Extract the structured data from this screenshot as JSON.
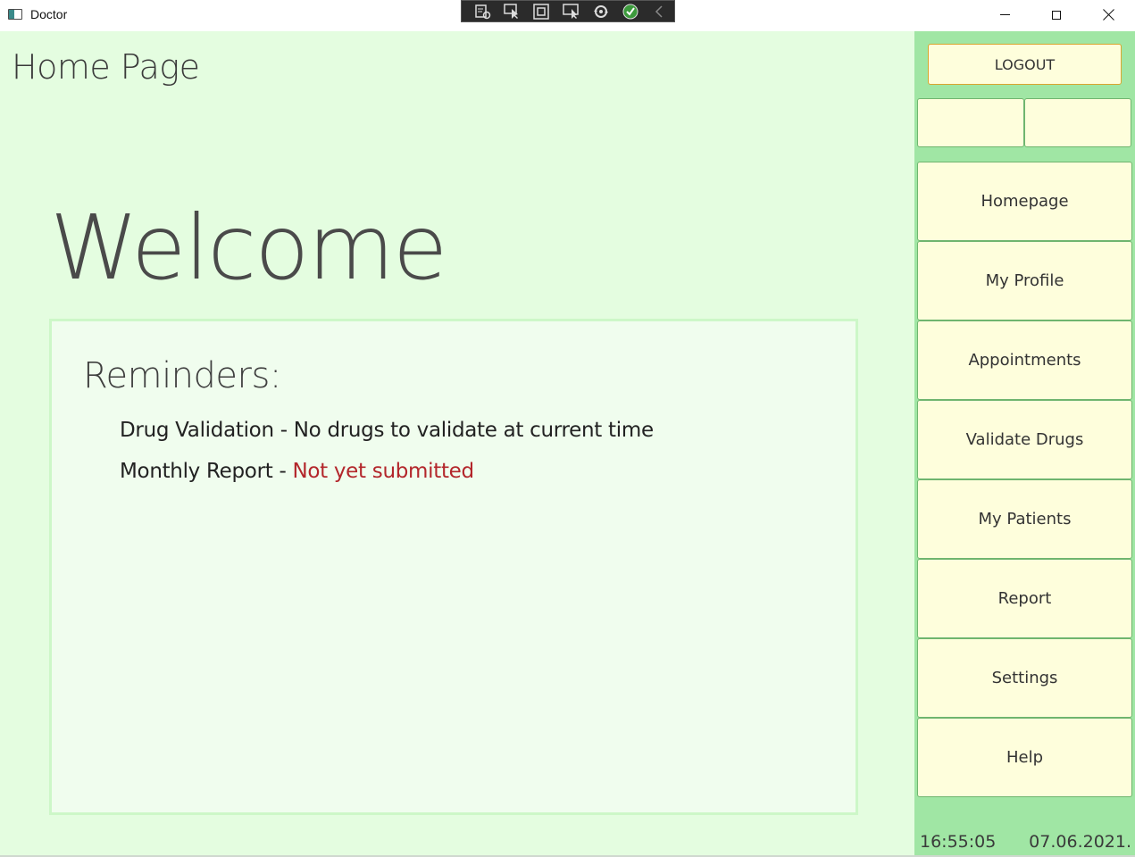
{
  "window": {
    "title": "Doctor"
  },
  "main": {
    "page_title": "Home Page",
    "welcome": "Welcome",
    "reminders": {
      "title": "Reminders:",
      "items": [
        {
          "label": "Drug Validation - No drugs to validate at current time",
          "status": ""
        },
        {
          "label": "Monthly Report - ",
          "status": "Not yet submitted"
        }
      ],
      "status_color": "#b3262b"
    }
  },
  "sidebar": {
    "logout_label": "LOGOUT",
    "nav": [
      {
        "label": "Homepage"
      },
      {
        "label": "My Profile"
      },
      {
        "label": "Appointments"
      },
      {
        "label": "Validate Drugs"
      },
      {
        "label": "My Patients"
      },
      {
        "label": "Report"
      },
      {
        "label": "Settings"
      },
      {
        "label": "Help"
      }
    ],
    "time": "16:55:05",
    "date": "07.06.2021."
  },
  "colors": {
    "main_bg": "#e4fde0",
    "sidebar_bg": "#a0e6a4",
    "button_bg": "#fefedc",
    "logout_border": "#d9a52f"
  },
  "debug_toolbar": {
    "icons": [
      "live-visual-tree-icon",
      "select-element-icon",
      "display-layout-adorners-icon",
      "track-focus-icon",
      "hot-reload-icon",
      "binding-failures-check-icon",
      "collapse-chevron-icon"
    ]
  }
}
